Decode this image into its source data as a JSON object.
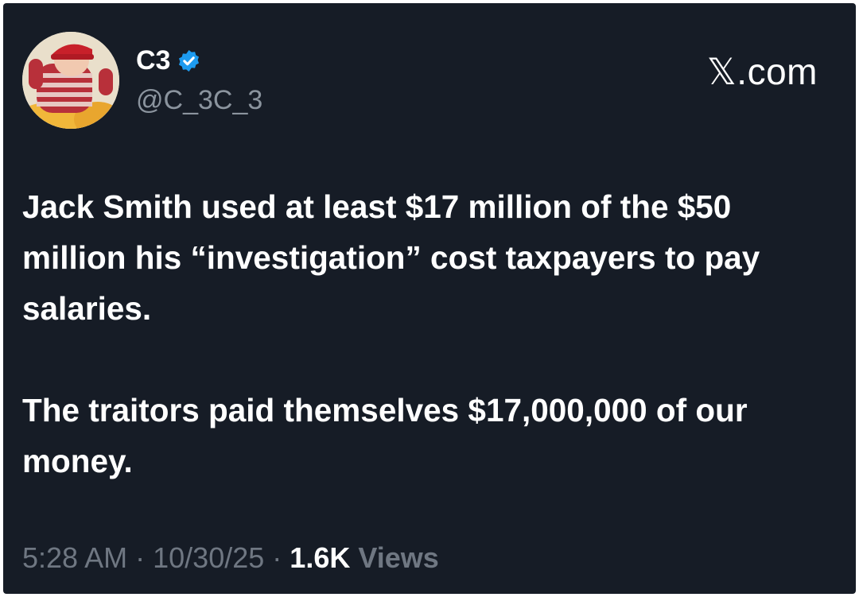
{
  "post": {
    "author": {
      "display_name": "C3",
      "handle": "@C_3C_3",
      "verified": true,
      "verified_color": "#1d9bf0"
    },
    "site": "𝕏.com",
    "body": [
      "Jack Smith used at least $17 million of the $50 million his “investigation” cost taxpayers to pay salaries.",
      "The traitors paid themselves $17,000,000 of our money."
    ],
    "meta": {
      "time": "5:28 AM",
      "separator": "·",
      "date": "10/30/25",
      "views_count": "1.6K",
      "views_label": "Views"
    }
  },
  "theme": {
    "background": "#161c26",
    "text": "#ffffff",
    "muted": "#8b949e"
  }
}
